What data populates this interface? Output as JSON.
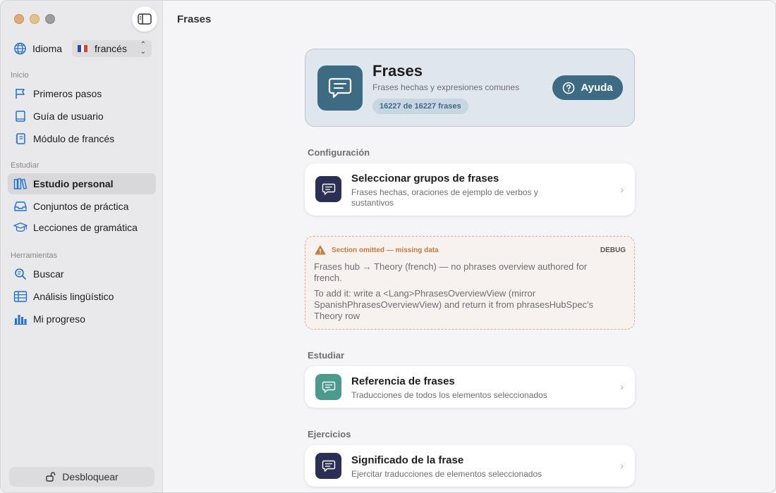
{
  "window": {
    "title": "Frases"
  },
  "sidebar": {
    "language": {
      "label": "Idioma",
      "value": "francés"
    },
    "sections": [
      {
        "label": "Inicio",
        "items": [
          {
            "label": "Primeros pasos",
            "icon": "flag-icon"
          },
          {
            "label": "Guía de usuario",
            "icon": "book-icon"
          },
          {
            "label": "Módulo de francés",
            "icon": "notebook-icon"
          }
        ]
      },
      {
        "label": "Estudiar",
        "items": [
          {
            "label": "Estudio personal",
            "icon": "books-icon",
            "active": true
          },
          {
            "label": "Conjuntos de práctica",
            "icon": "tray-icon"
          },
          {
            "label": "Lecciones de gramática",
            "icon": "graduation-cap-icon"
          }
        ]
      },
      {
        "label": "Herramientas",
        "items": [
          {
            "label": "Buscar",
            "icon": "search-icon"
          },
          {
            "label": "Análisis lingüístico",
            "icon": "table-icon"
          },
          {
            "label": "Mi progreso",
            "icon": "bar-chart-icon"
          }
        ]
      }
    ],
    "unlock_label": "Desbloquear"
  },
  "hero": {
    "title": "Frases",
    "subtitle": "Frases hechas y expresiones comunes",
    "badge": "16227 de 16227 frases",
    "help_label": "Ayuda"
  },
  "groups": {
    "config": {
      "label": "Configuración",
      "card": {
        "title": "Seleccionar grupos de frases",
        "subtitle": "Frases hechas, oraciones de ejemplo de verbos y sustantivos"
      }
    },
    "debug": {
      "warning": "Section omitted — missing data",
      "tag": "DEBUG",
      "line1": "Frases hub → Theory (french) — no phrases overview authored for french.",
      "line2": "To add it: write a <Lang>PhrasesOverviewView (mirror SpanishPhrasesOverviewView) and return it from phrasesHubSpec's Theory row"
    },
    "study": {
      "label": "Estudiar",
      "card": {
        "title": "Referencia de frases",
        "subtitle": "Traducciones de todos los elementos seleccionados"
      }
    },
    "exercises": {
      "label": "Ejercicios",
      "card": {
        "title": "Significado de la frase",
        "subtitle": "Ejercitar traducciones de elementos seleccionados"
      }
    }
  },
  "colors": {
    "accent": "#3e6b84",
    "warning": "#c67a3e"
  }
}
